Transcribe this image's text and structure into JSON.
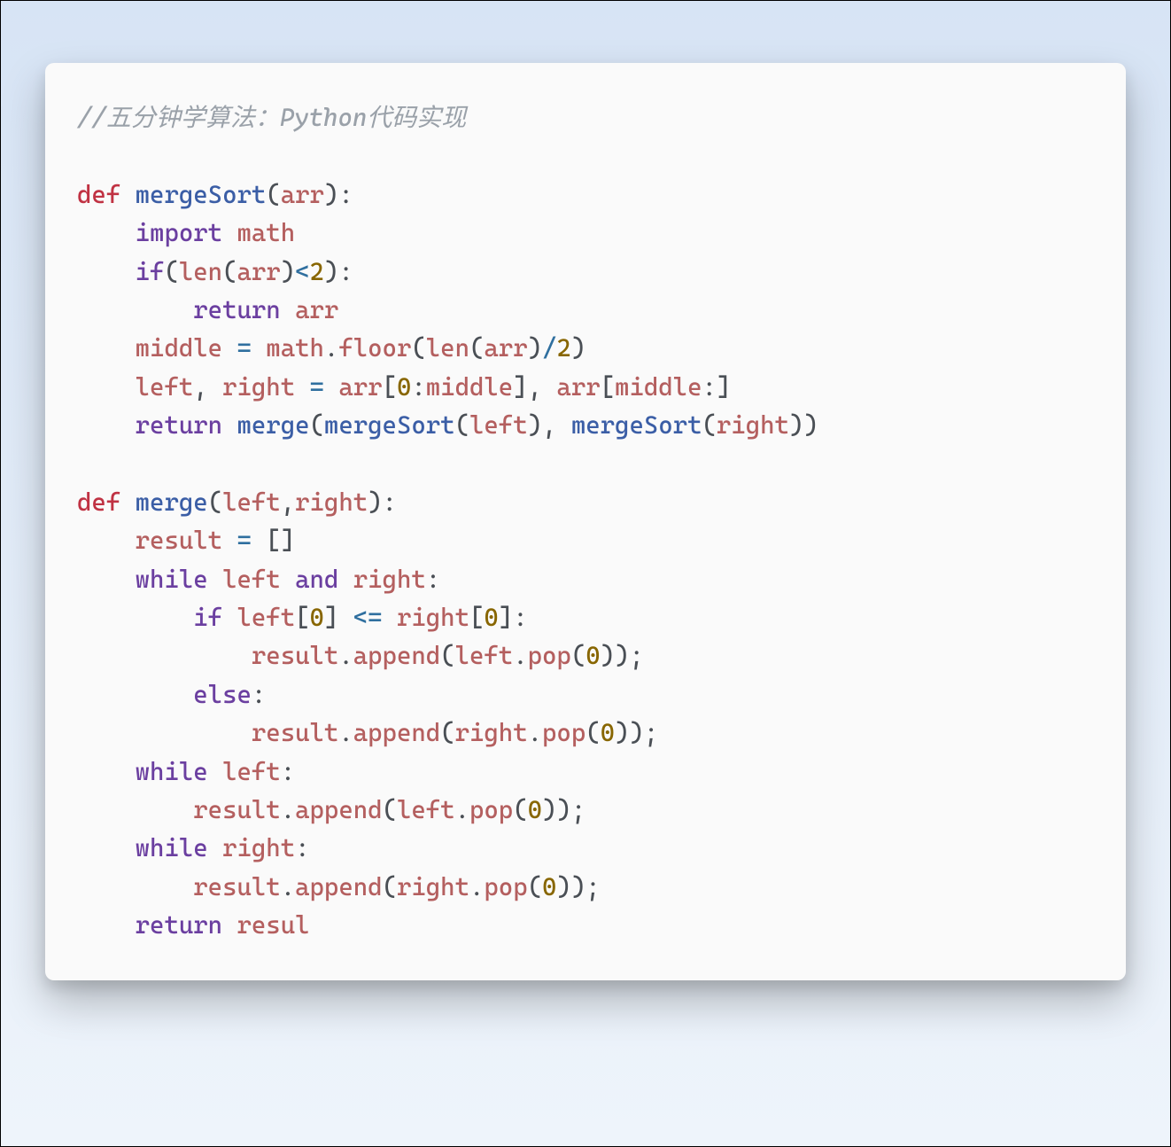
{
  "code": {
    "tokens": [
      [
        {
          "c": "comment",
          "t": "//五分钟学算法：Python代码实现"
        }
      ],
      [],
      [
        {
          "c": "kw-def",
          "t": "def"
        },
        {
          "c": "punct",
          "t": " "
        },
        {
          "c": "fn-name",
          "t": "mergeSort"
        },
        {
          "c": "paren",
          "t": "("
        },
        {
          "c": "var",
          "t": "arr"
        },
        {
          "c": "paren",
          "t": ")"
        },
        {
          "c": "punct",
          "t": ":"
        }
      ],
      [
        {
          "c": "punct",
          "t": "    "
        },
        {
          "c": "kw-imp",
          "t": "import"
        },
        {
          "c": "punct",
          "t": " "
        },
        {
          "c": "var",
          "t": "math"
        }
      ],
      [
        {
          "c": "punct",
          "t": "    "
        },
        {
          "c": "kw-flow",
          "t": "if"
        },
        {
          "c": "paren",
          "t": "("
        },
        {
          "c": "builtin",
          "t": "len"
        },
        {
          "c": "paren",
          "t": "("
        },
        {
          "c": "var",
          "t": "arr"
        },
        {
          "c": "paren",
          "t": ")"
        },
        {
          "c": "op",
          "t": "<"
        },
        {
          "c": "num",
          "t": "2"
        },
        {
          "c": "paren",
          "t": ")"
        },
        {
          "c": "punct",
          "t": ":"
        }
      ],
      [
        {
          "c": "punct",
          "t": "        "
        },
        {
          "c": "kw-flow",
          "t": "return"
        },
        {
          "c": "punct",
          "t": " "
        },
        {
          "c": "var",
          "t": "arr"
        }
      ],
      [
        {
          "c": "punct",
          "t": "    "
        },
        {
          "c": "var",
          "t": "middle"
        },
        {
          "c": "punct",
          "t": " "
        },
        {
          "c": "op",
          "t": "="
        },
        {
          "c": "punct",
          "t": " "
        },
        {
          "c": "var",
          "t": "math"
        },
        {
          "c": "punct",
          "t": "."
        },
        {
          "c": "builtin",
          "t": "floor"
        },
        {
          "c": "paren",
          "t": "("
        },
        {
          "c": "builtin",
          "t": "len"
        },
        {
          "c": "paren",
          "t": "("
        },
        {
          "c": "var",
          "t": "arr"
        },
        {
          "c": "paren",
          "t": ")"
        },
        {
          "c": "op",
          "t": "/"
        },
        {
          "c": "num",
          "t": "2"
        },
        {
          "c": "paren",
          "t": ")"
        }
      ],
      [
        {
          "c": "punct",
          "t": "    "
        },
        {
          "c": "var",
          "t": "left"
        },
        {
          "c": "punct",
          "t": ", "
        },
        {
          "c": "var",
          "t": "right"
        },
        {
          "c": "punct",
          "t": " "
        },
        {
          "c": "op",
          "t": "="
        },
        {
          "c": "punct",
          "t": " "
        },
        {
          "c": "var",
          "t": "arr"
        },
        {
          "c": "paren",
          "t": "["
        },
        {
          "c": "num",
          "t": "0"
        },
        {
          "c": "punct",
          "t": ":"
        },
        {
          "c": "var",
          "t": "middle"
        },
        {
          "c": "paren",
          "t": "]"
        },
        {
          "c": "punct",
          "t": ", "
        },
        {
          "c": "var",
          "t": "arr"
        },
        {
          "c": "paren",
          "t": "["
        },
        {
          "c": "var",
          "t": "middle"
        },
        {
          "c": "punct",
          "t": ":"
        },
        {
          "c": "paren",
          "t": "]"
        }
      ],
      [
        {
          "c": "punct",
          "t": "    "
        },
        {
          "c": "kw-flow",
          "t": "return"
        },
        {
          "c": "punct",
          "t": " "
        },
        {
          "c": "fn-name",
          "t": "merge"
        },
        {
          "c": "paren",
          "t": "("
        },
        {
          "c": "fn-name",
          "t": "mergeSort"
        },
        {
          "c": "paren",
          "t": "("
        },
        {
          "c": "var",
          "t": "left"
        },
        {
          "c": "paren",
          "t": ")"
        },
        {
          "c": "punct",
          "t": ", "
        },
        {
          "c": "fn-name",
          "t": "mergeSort"
        },
        {
          "c": "paren",
          "t": "("
        },
        {
          "c": "var",
          "t": "right"
        },
        {
          "c": "paren",
          "t": ")"
        },
        {
          "c": "paren",
          "t": ")"
        }
      ],
      [],
      [
        {
          "c": "kw-def",
          "t": "def"
        },
        {
          "c": "punct",
          "t": " "
        },
        {
          "c": "fn-name",
          "t": "merge"
        },
        {
          "c": "paren",
          "t": "("
        },
        {
          "c": "var",
          "t": "left"
        },
        {
          "c": "punct",
          "t": ","
        },
        {
          "c": "var",
          "t": "right"
        },
        {
          "c": "paren",
          "t": ")"
        },
        {
          "c": "punct",
          "t": ":"
        }
      ],
      [
        {
          "c": "punct",
          "t": "    "
        },
        {
          "c": "var",
          "t": "result"
        },
        {
          "c": "punct",
          "t": " "
        },
        {
          "c": "op",
          "t": "="
        },
        {
          "c": "punct",
          "t": " "
        },
        {
          "c": "paren",
          "t": "[]"
        }
      ],
      [
        {
          "c": "punct",
          "t": "    "
        },
        {
          "c": "kw-flow",
          "t": "while"
        },
        {
          "c": "punct",
          "t": " "
        },
        {
          "c": "var",
          "t": "left"
        },
        {
          "c": "punct",
          "t": " "
        },
        {
          "c": "kw-flow",
          "t": "and"
        },
        {
          "c": "punct",
          "t": " "
        },
        {
          "c": "var",
          "t": "right"
        },
        {
          "c": "punct",
          "t": ":"
        }
      ],
      [
        {
          "c": "punct",
          "t": "        "
        },
        {
          "c": "kw-flow",
          "t": "if"
        },
        {
          "c": "punct",
          "t": " "
        },
        {
          "c": "var",
          "t": "left"
        },
        {
          "c": "paren",
          "t": "["
        },
        {
          "c": "num",
          "t": "0"
        },
        {
          "c": "paren",
          "t": "]"
        },
        {
          "c": "punct",
          "t": " "
        },
        {
          "c": "op",
          "t": "<="
        },
        {
          "c": "punct",
          "t": " "
        },
        {
          "c": "var",
          "t": "right"
        },
        {
          "c": "paren",
          "t": "["
        },
        {
          "c": "num",
          "t": "0"
        },
        {
          "c": "paren",
          "t": "]"
        },
        {
          "c": "punct",
          "t": ":"
        }
      ],
      [
        {
          "c": "punct",
          "t": "            "
        },
        {
          "c": "var",
          "t": "result"
        },
        {
          "c": "punct",
          "t": "."
        },
        {
          "c": "builtin",
          "t": "append"
        },
        {
          "c": "paren",
          "t": "("
        },
        {
          "c": "var",
          "t": "left"
        },
        {
          "c": "punct",
          "t": "."
        },
        {
          "c": "builtin",
          "t": "pop"
        },
        {
          "c": "paren",
          "t": "("
        },
        {
          "c": "num",
          "t": "0"
        },
        {
          "c": "paren",
          "t": ")"
        },
        {
          "c": "paren",
          "t": ")"
        },
        {
          "c": "punct",
          "t": ";"
        }
      ],
      [
        {
          "c": "punct",
          "t": "        "
        },
        {
          "c": "kw-flow",
          "t": "else"
        },
        {
          "c": "punct",
          "t": ":"
        }
      ],
      [
        {
          "c": "punct",
          "t": "            "
        },
        {
          "c": "var",
          "t": "result"
        },
        {
          "c": "punct",
          "t": "."
        },
        {
          "c": "builtin",
          "t": "append"
        },
        {
          "c": "paren",
          "t": "("
        },
        {
          "c": "var",
          "t": "right"
        },
        {
          "c": "punct",
          "t": "."
        },
        {
          "c": "builtin",
          "t": "pop"
        },
        {
          "c": "paren",
          "t": "("
        },
        {
          "c": "num",
          "t": "0"
        },
        {
          "c": "paren",
          "t": ")"
        },
        {
          "c": "paren",
          "t": ")"
        },
        {
          "c": "punct",
          "t": ";"
        }
      ],
      [
        {
          "c": "punct",
          "t": "    "
        },
        {
          "c": "kw-flow",
          "t": "while"
        },
        {
          "c": "punct",
          "t": " "
        },
        {
          "c": "var",
          "t": "left"
        },
        {
          "c": "punct",
          "t": ":"
        }
      ],
      [
        {
          "c": "punct",
          "t": "        "
        },
        {
          "c": "var",
          "t": "result"
        },
        {
          "c": "punct",
          "t": "."
        },
        {
          "c": "builtin",
          "t": "append"
        },
        {
          "c": "paren",
          "t": "("
        },
        {
          "c": "var",
          "t": "left"
        },
        {
          "c": "punct",
          "t": "."
        },
        {
          "c": "builtin",
          "t": "pop"
        },
        {
          "c": "paren",
          "t": "("
        },
        {
          "c": "num",
          "t": "0"
        },
        {
          "c": "paren",
          "t": ")"
        },
        {
          "c": "paren",
          "t": ")"
        },
        {
          "c": "punct",
          "t": ";"
        }
      ],
      [
        {
          "c": "punct",
          "t": "    "
        },
        {
          "c": "kw-flow",
          "t": "while"
        },
        {
          "c": "punct",
          "t": " "
        },
        {
          "c": "var",
          "t": "right"
        },
        {
          "c": "punct",
          "t": ":"
        }
      ],
      [
        {
          "c": "punct",
          "t": "        "
        },
        {
          "c": "var",
          "t": "result"
        },
        {
          "c": "punct",
          "t": "."
        },
        {
          "c": "builtin",
          "t": "append"
        },
        {
          "c": "paren",
          "t": "("
        },
        {
          "c": "var",
          "t": "right"
        },
        {
          "c": "punct",
          "t": "."
        },
        {
          "c": "builtin",
          "t": "pop"
        },
        {
          "c": "paren",
          "t": "("
        },
        {
          "c": "num",
          "t": "0"
        },
        {
          "c": "paren",
          "t": ")"
        },
        {
          "c": "paren",
          "t": ")"
        },
        {
          "c": "punct",
          "t": ";"
        }
      ],
      [
        {
          "c": "punct",
          "t": "    "
        },
        {
          "c": "kw-flow",
          "t": "return"
        },
        {
          "c": "punct",
          "t": " "
        },
        {
          "c": "var",
          "t": "resul"
        }
      ]
    ]
  }
}
